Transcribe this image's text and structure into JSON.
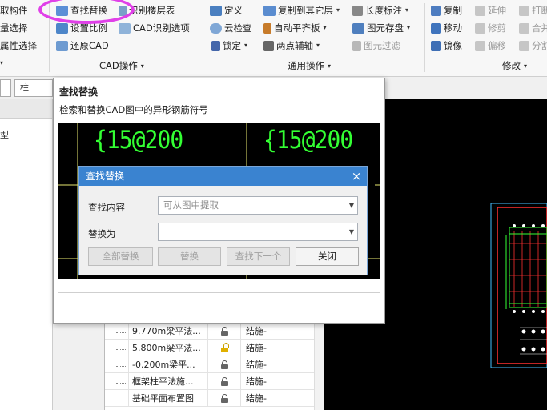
{
  "ribbon": {
    "col0": [
      "取构件",
      "量选择",
      "属性选择"
    ],
    "cad_ops": {
      "find_replace": "查找替换",
      "identify_floor_table": "识别楼层表",
      "set_scale": "设置比例",
      "cad_identify_options": "CAD识别选项",
      "restore_cad": "还原CAD",
      "group_label": "CAD操作"
    },
    "general_ops": {
      "define": "定义",
      "copy_to_other_floor": "复制到其它层",
      "length_mark": "长度标注",
      "cloud_check": "云检查",
      "auto_align_slab": "自动平齐板",
      "layer_save": "图元存盘",
      "lock": "锁定",
      "two_point_aux": "两点辅轴",
      "element_filter": "图元过滤",
      "group_label": "通用操作"
    },
    "modify": {
      "copy": "复制",
      "extend": "延伸",
      "break": "打断",
      "move": "移动",
      "trim": "修剪",
      "merge": "合并",
      "mirror": "镜像",
      "offset": "偏移",
      "split": "分割",
      "group_label": "修改"
    }
  },
  "left": {
    "combo_value": "柱",
    "item_text": "型"
  },
  "outer_dialog": {
    "title": "查找替换",
    "description": "检索和替换CAD图中的异形钢筋符号",
    "preview_texts": [
      "{15@200",
      "{15@200"
    ]
  },
  "dialog": {
    "title": "查找替换",
    "close": "×",
    "find_label": "查找内容",
    "find_placeholder": "可从图中提取",
    "replace_label": "替换为",
    "replace_value": "",
    "buttons": {
      "replace_all": "全部替换",
      "replace": "替换",
      "find_next": "查找下一个",
      "close": "关闭"
    }
  },
  "layer_list": [
    {
      "name": "9.770m梁平法...",
      "lock": "locked",
      "type": "结施-"
    },
    {
      "name": "5.800m梁平法...",
      "lock": "unlocked",
      "type": "结施-"
    },
    {
      "name": "-0.200m梁平...",
      "lock": "locked",
      "type": "结施-"
    },
    {
      "name": "框架柱平法施...",
      "lock": "locked",
      "type": "结施-"
    },
    {
      "name": "基础平面布置图",
      "lock": "locked",
      "type": "结施-"
    }
  ],
  "colors": {
    "dialog_title_bar": "#3a83d0",
    "cad_green": "#33ff33",
    "highlight": "#e040e8"
  }
}
